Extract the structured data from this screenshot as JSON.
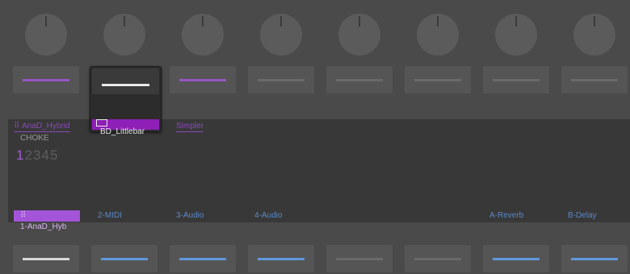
{
  "colors": {
    "background": "#4a4a4a",
    "purple_accent": "#9755c6",
    "blue_accent": "#5f98dc",
    "selected_chip": "#8e1fb7"
  },
  "top_pads": [
    {
      "bar": "purple"
    },
    {
      "bar": "white"
    },
    {
      "bar": "purple"
    },
    {
      "bar": "grey"
    },
    {
      "bar": "grey"
    },
    {
      "bar": "grey"
    },
    {
      "bar": "grey"
    },
    {
      "bar": "grey"
    }
  ],
  "bottom_pads": [
    {
      "bar": "white"
    },
    {
      "bar": "blue"
    },
    {
      "bar": "blue"
    },
    {
      "bar": "blue"
    },
    {
      "bar": "grey"
    },
    {
      "bar": "grey"
    },
    {
      "bar": "blue"
    },
    {
      "bar": "blue"
    }
  ],
  "display": {
    "breadcrumb": {
      "rack": "AnaD_Hybrid",
      "device": "Simpler"
    },
    "choke_label": "CHOKE",
    "choke_values": {
      "selected": "1",
      "others": "2345"
    },
    "tracks": [
      "1-AnaD_Hyb",
      "2-MIDI",
      "3-Audio",
      "4-Audio",
      "A-Reverb",
      "B-Delay"
    ]
  },
  "overlay": {
    "label": "BD_Littlebar"
  }
}
